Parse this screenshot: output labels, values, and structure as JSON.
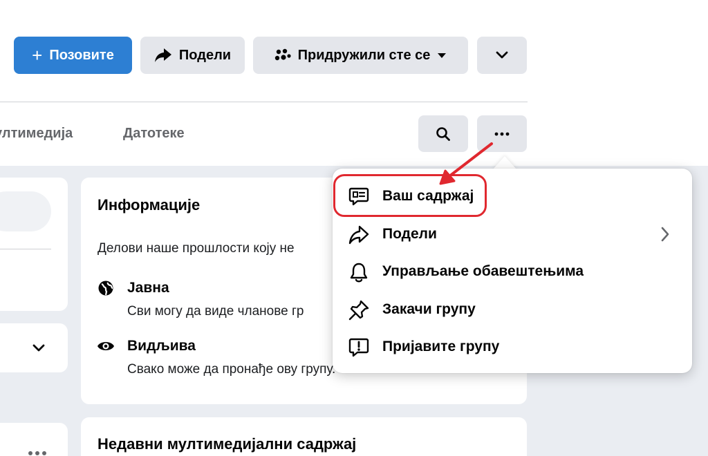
{
  "header": {
    "invite_label": "Позовите",
    "share_label": "Подели",
    "joined_label": "Придружили сте се"
  },
  "tabs": [
    {
      "label": "ултимедија"
    },
    {
      "label": "Датотеке"
    }
  ],
  "about": {
    "title": "Информације",
    "description": "Делови наше прошлости коју не",
    "privacy_title": "Јавна",
    "privacy_text": "Сви могу да виде чланове гр",
    "visibility_title": "Видљива",
    "visibility_text": "Свако може да пронађе ову групу."
  },
  "recent_media": {
    "title": "Недавни мултимедијални садржај"
  },
  "menu": {
    "items": [
      {
        "label": "Ваш садржај",
        "icon": "your-content-icon"
      },
      {
        "label": "Подели",
        "icon": "share-icon"
      },
      {
        "label": "Управљање обавештењима",
        "icon": "bell-icon"
      },
      {
        "label": "Закачи групу",
        "icon": "pin-icon"
      },
      {
        "label": "Пријавите групу",
        "icon": "report-icon"
      }
    ]
  },
  "colors": {
    "primary": "#2d7fd3",
    "highlight": "#e0282f",
    "background": "#eaedf2"
  }
}
